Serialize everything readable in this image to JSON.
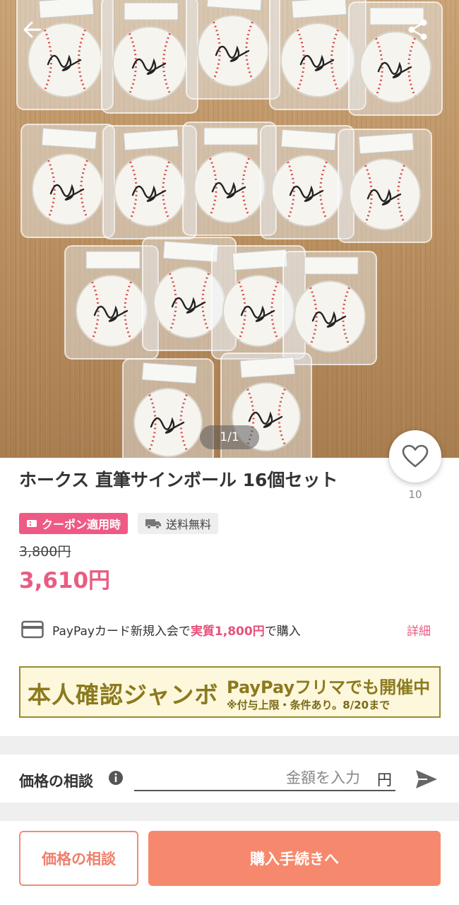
{
  "photo": {
    "image_counter": "1/1",
    "back_icon": "arrow-left-icon",
    "share_icon": "share-icon"
  },
  "like": {
    "icon": "heart-icon",
    "count": "10"
  },
  "product": {
    "title": "ホークス 直筆サインボール 16個セット",
    "badges": {
      "coupon_label": "クーポン適用時",
      "shipping_label": "送料無料"
    },
    "original_price": "3,800円",
    "price": "3,610円"
  },
  "paypay_card": {
    "icon": "credit-card-icon",
    "text_before": "PayPayカード新規入会で",
    "text_highlight": "実質1,800円",
    "text_after": "で購入",
    "detail_link": "詳細"
  },
  "banner": {
    "main_text": "本人確認ジャンボ",
    "sub_text_1": "PayPayフリマでも開催中",
    "sub_text_2": "※付与上限・条件あり。8/20まで"
  },
  "negotiation": {
    "label": "価格の相談",
    "info_icon": "info-icon",
    "input_placeholder": "金額を入力",
    "unit": "円",
    "send_icon": "send-icon"
  },
  "bottom_bar": {
    "negotiate_button": "価格の相談",
    "purchase_button": "購入手続きへ"
  },
  "colors": {
    "accent_pink": "#e95c82",
    "coupon_badge": "#ef5a84",
    "purchase_button": "#f6896d",
    "negotiate_border": "#f18c78"
  }
}
